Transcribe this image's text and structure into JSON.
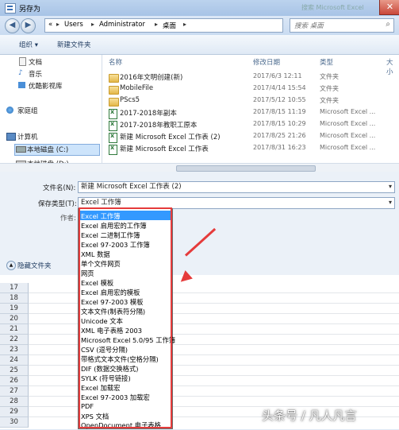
{
  "window": {
    "title": "另存为",
    "close_glyph": "✕",
    "ghost_search": "搜索 Microsoft Excel"
  },
  "nav": {
    "back_glyph": "◀",
    "forward_glyph": "▶",
    "breadcrumbs": [
      "«",
      "Users",
      "Administrator",
      "桌面"
    ],
    "separator": "▸",
    "search_placeholder": "搜索 桌面"
  },
  "toolbar": {
    "organize": "组织 ▾",
    "new_folder": "新建文件夹"
  },
  "sidebar": {
    "items": [
      {
        "label": "文档",
        "icon": "document-icon"
      },
      {
        "label": "音乐",
        "icon": "music-icon"
      },
      {
        "label": "优酷影视库",
        "icon": "video-library-icon"
      },
      {
        "label": "家庭组",
        "icon": "homegroup-icon"
      },
      {
        "label": "计算机",
        "icon": "computer-icon"
      },
      {
        "label": "本地磁盘 (C:)",
        "icon": "drive-icon"
      },
      {
        "label": "本地磁盘 (D:)",
        "icon": "drive-icon"
      }
    ]
  },
  "filelist": {
    "headers": {
      "name": "名称",
      "date": "修改日期",
      "type": "类型",
      "size": "大小"
    },
    "rows": [
      {
        "name": "2016年文明创建(新)",
        "date": "2017/6/3 12:11",
        "type": "文件夹",
        "icon": "folder-icon"
      },
      {
        "name": "MobileFile",
        "date": "2017/4/14 15:54",
        "type": "文件夹",
        "icon": "folder-icon"
      },
      {
        "name": "PScs5",
        "date": "2017/5/12 10:55",
        "type": "文件夹",
        "icon": "folder-icon"
      },
      {
        "name": "2017-2018年副本",
        "date": "2017/8/15 11:19",
        "type": "Microsoft Excel ...",
        "icon": "excel-file-icon"
      },
      {
        "name": "2017-2018年教职工原本",
        "date": "2017/8/15 10:29",
        "type": "Microsoft Excel ...",
        "icon": "excel-file-icon"
      },
      {
        "name": "新建 Microsoft Excel 工作表 (2)",
        "date": "2017/8/25 21:26",
        "type": "Microsoft Excel ...",
        "icon": "excel-file-icon"
      },
      {
        "name": "新建 Microsoft Excel 工作表",
        "date": "2017/8/31 16:23",
        "type": "Microsoft Excel ...",
        "icon": "excel-file-icon"
      }
    ]
  },
  "form": {
    "filename_label": "文件名(N):",
    "filename_value": "新建 Microsoft Excel 工作表 (2)",
    "savetype_label": "保存类型(T):",
    "savetype_value": "Excel 工作簿",
    "author_label": "作者:",
    "hide_folders": "隐藏文件夹",
    "arrow_glyph": "▾"
  },
  "sheet_rows": [
    "17",
    "18",
    "19",
    "20",
    "21",
    "22",
    "23",
    "24",
    "25",
    "26",
    "27",
    "28",
    "29",
    "30"
  ],
  "dropdown_options": [
    "Excel 工作簿",
    "Excel 启用宏的工作簿",
    "Excel 二进制工作簿",
    "Excel 97-2003 工作簿",
    "XML 数据",
    "单个文件网页",
    "网页",
    "Excel 模板",
    "Excel 启用宏的模板",
    "Excel 97-2003 模板",
    "文本文件(制表符分隔)",
    "Unicode 文本",
    "XML 电子表格 2003",
    "Microsoft Excel 5.0/95 工作簿",
    "CSV (逗号分隔)",
    "带格式文本文件(空格分隔)",
    "DIF (数据交换格式)",
    "SYLK (符号链接)",
    "Excel 加载宏",
    "Excel 97-2003 加载宏",
    "PDF",
    "XPS 文档",
    "OpenDocument 电子表格"
  ],
  "watermark": "头条号 / 凡人凡言",
  "colors": {
    "annotation": "#e53b3b",
    "selection": "#3399ff"
  }
}
